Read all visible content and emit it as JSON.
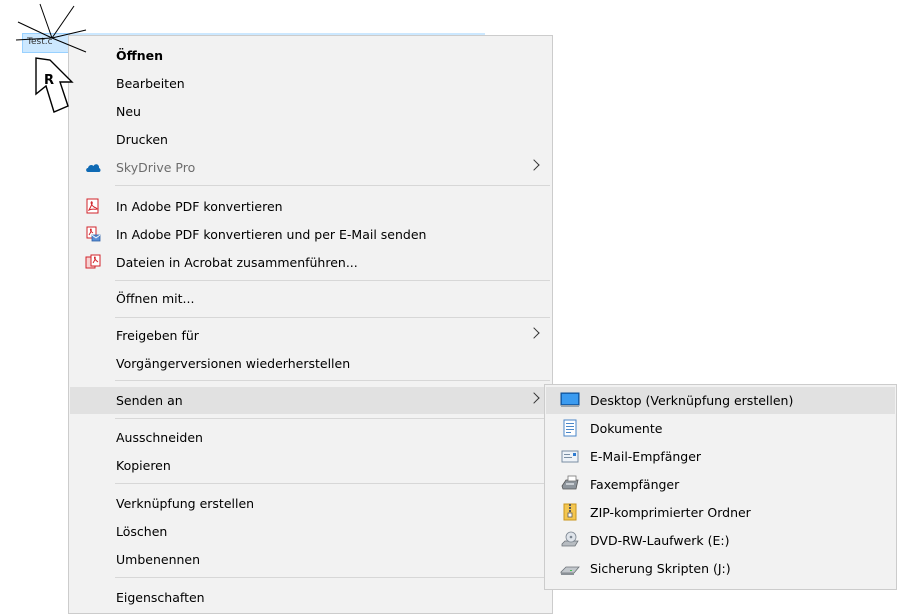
{
  "file": {
    "name": "Test.c"
  },
  "context_menu": {
    "items": [
      {
        "label": "Öffnen",
        "bold": true
      },
      {
        "label": "Bearbeiten"
      },
      {
        "label": "Neu"
      },
      {
        "label": "Drucken"
      },
      {
        "label": "SkyDrive Pro",
        "icon": "skydrive-cloud-icon",
        "submenu": true,
        "disabled": true
      },
      {
        "label": "In Adobe PDF konvertieren",
        "icon": "adobe-pdf-icon"
      },
      {
        "label": "In Adobe PDF konvertieren und per E-Mail senden",
        "icon": "adobe-pdf-email-icon"
      },
      {
        "label": "Dateien in Acrobat zusammenführen...",
        "icon": "acrobat-combine-icon"
      },
      {
        "label": "Öffnen mit..."
      },
      {
        "label": "Freigeben für",
        "submenu": true
      },
      {
        "label": "Vorgängerversionen wiederherstellen"
      },
      {
        "label": "Senden an",
        "submenu": true,
        "highlighted": true
      },
      {
        "label": "Ausschneiden"
      },
      {
        "label": "Kopieren"
      },
      {
        "label": "Verknüpfung erstellen"
      },
      {
        "label": "Löschen"
      },
      {
        "label": "Umbenennen"
      },
      {
        "label": "Eigenschaften"
      }
    ]
  },
  "send_to_menu": {
    "items": [
      {
        "label": "Desktop (Verknüpfung erstellen)",
        "icon": "desktop-icon",
        "highlighted": true
      },
      {
        "label": "Dokumente",
        "icon": "documents-icon"
      },
      {
        "label": "E-Mail-Empfänger",
        "icon": "mail-recipient-icon"
      },
      {
        "label": "Faxempfänger",
        "icon": "fax-icon"
      },
      {
        "label": "ZIP-komprimierter Ordner",
        "icon": "zip-folder-icon"
      },
      {
        "label": "DVD-RW-Laufwerk (E:)",
        "icon": "dvd-drive-icon"
      },
      {
        "label": "Sicherung Skripten (J:)",
        "icon": "network-drive-icon"
      }
    ]
  },
  "cursor": {
    "button_letter": "R"
  },
  "colors": {
    "menu_bg": "#f2f2f2",
    "highlight": "#e1e1e1",
    "selection": "#cce8ff",
    "pdf_red": "#d2232a",
    "skydrive_blue": "#0f6ab4"
  }
}
